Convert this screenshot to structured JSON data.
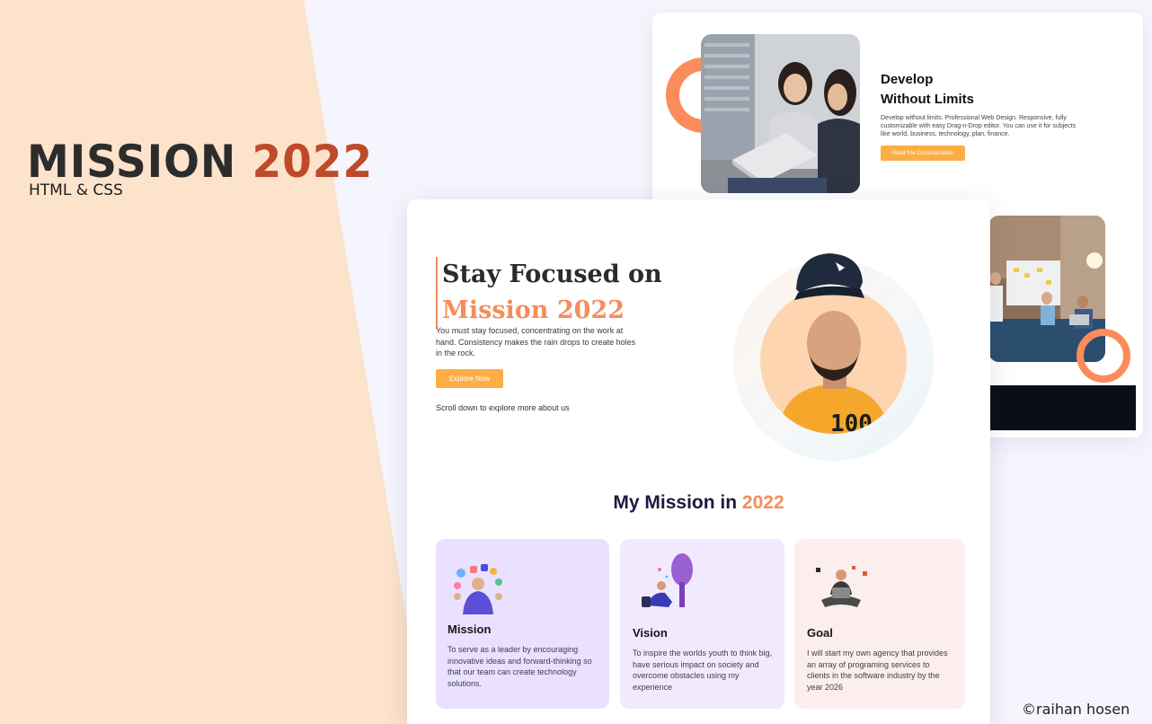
{
  "brand": {
    "title_part1": "MISSION",
    "title_part2": "2022",
    "subtitle": "HTML & CSS"
  },
  "back_card": {
    "title_line1": "Develop",
    "title_line2": "Without Limits",
    "description": "Develop without limits. Professional Web Design. Responsive, fully customizable with easy Drag-n-Drop editor. You can use it for subjects like world, business, technology, plan, finance.",
    "button_label": "Read The Documentation"
  },
  "hero": {
    "heading_line1": "Stay Focused on",
    "heading_line2": "Mission 2022",
    "description": "You must stay focused, concentrating on the work at hand. Consistency makes the rain drops to create holes in the rock.",
    "button_label": "Explore Now",
    "scroll_note": "Scroll down to explore more about us"
  },
  "mission_section": {
    "heading_part1": "My Mission in",
    "heading_year": "2022"
  },
  "cards": [
    {
      "title": "Mission",
      "text": "To serve as a leader by encouraging innovative ideas and forward-thinking so that our team can create technology solutions."
    },
    {
      "title": "Vision",
      "text": "To inspire the worlds youth to think big, have serious impact on society and overcome obstacles using my experience"
    },
    {
      "title": "Goal",
      "text": "I will start my own agency that provides an array of programing services to clients in the software industry by the year 2026"
    }
  ],
  "credit": "©raihan hosen",
  "colors": {
    "accent_orange": "#f58d5c",
    "button_orange": "#fcae44",
    "brand_rust": "#bf4a2a",
    "peach_bg": "#fde3cb",
    "navy_text": "#1d1a3e"
  }
}
